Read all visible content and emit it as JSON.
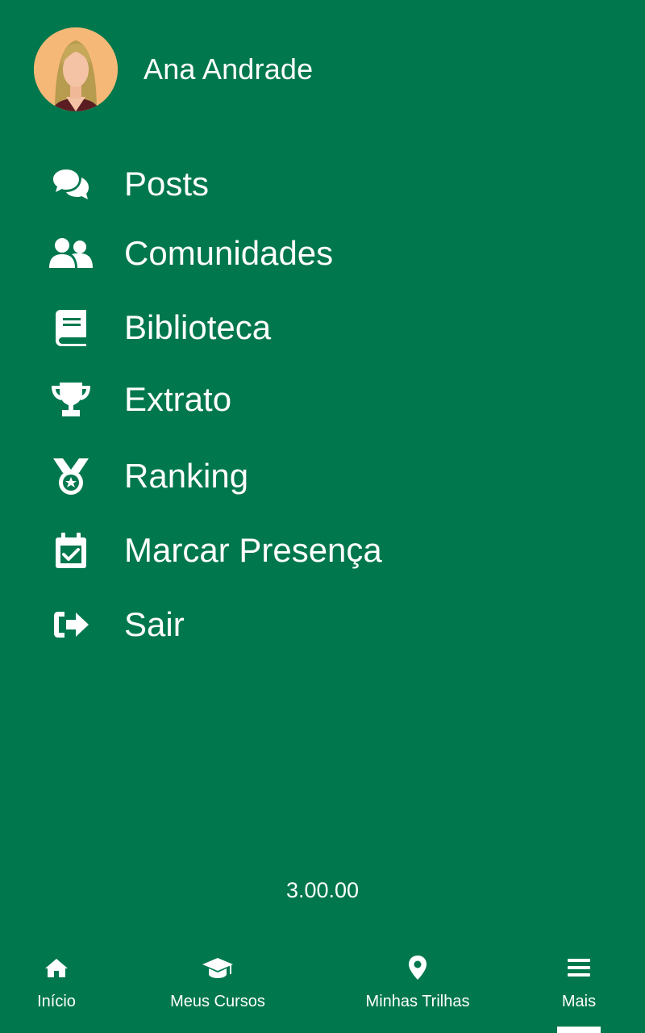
{
  "user": {
    "name": "Ana Andrade"
  },
  "menu": {
    "items": [
      {
        "label": "Posts",
        "icon": "comments-icon"
      },
      {
        "label": "Comunidades",
        "icon": "users-icon"
      },
      {
        "label": "Biblioteca",
        "icon": "book-icon"
      },
      {
        "label": "Extrato",
        "icon": "trophy-icon"
      },
      {
        "label": "Ranking",
        "icon": "medal-icon"
      },
      {
        "label": "Marcar Presença",
        "icon": "calendar-check-icon"
      },
      {
        "label": "Sair",
        "icon": "sign-out-icon"
      }
    ]
  },
  "version": "3.00.00",
  "bottom_nav": {
    "items": [
      {
        "label": "Início",
        "icon": "home-icon"
      },
      {
        "label": "Meus Cursos",
        "icon": "graduation-cap-icon"
      },
      {
        "label": "Minhas Trilhas",
        "icon": "map-pin-icon"
      },
      {
        "label": "Mais",
        "icon": "menu-icon",
        "active": true
      }
    ]
  },
  "colors": {
    "background": "#00774D",
    "foreground": "#FFFFFF",
    "avatar_bg": "#F6B876"
  }
}
